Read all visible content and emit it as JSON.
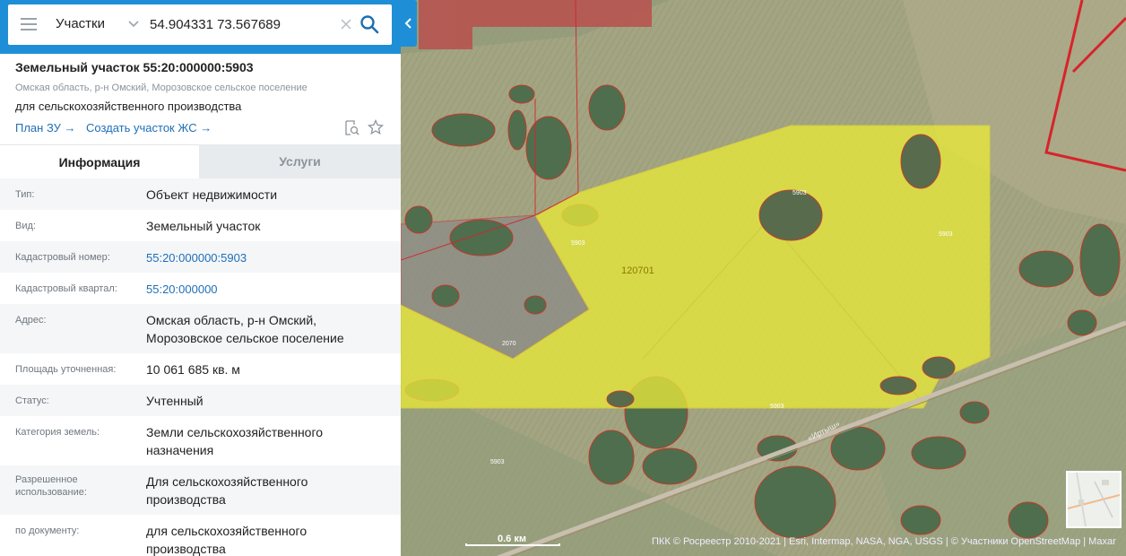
{
  "search": {
    "type_label": "Участки",
    "query": "54.904331 73.567689"
  },
  "object": {
    "title": "Земельный участок 55:20:000000:5903",
    "subtitle": "Омская область, р-н Омский, Морозовское сельское поселение",
    "purpose": "для сельскохозяйственного производства",
    "link_plan": "План ЗУ →",
    "link_create": "Создать участок ЖС →"
  },
  "tabs": {
    "info": "Информация",
    "services": "Услуги"
  },
  "info_rows": [
    {
      "label": "Тип:",
      "value": "Объект недвижимости"
    },
    {
      "label": "Вид:",
      "value": "Земельный участок"
    },
    {
      "label": "Кадастровый номер:",
      "value": "55:20:000000:5903"
    },
    {
      "label": "Кадастровый квартал:",
      "value": "55:20:000000"
    },
    {
      "label": "Адрес:",
      "value": "Омская область, р-н Омский, Морозовское сельское поселение"
    },
    {
      "label": "Площадь уточненная:",
      "value": "10 061 685 кв. м"
    },
    {
      "label": "Статус:",
      "value": "Учтенный"
    },
    {
      "label": "Категория земель:",
      "value": "Земли сельскохозяйственного назначения"
    },
    {
      "label": "Разрешенное использование:",
      "value": "Для сельскохозяйственного производства"
    },
    {
      "label": "по документу:",
      "value": "для сельскохозяйственного производства"
    }
  ],
  "map": {
    "parcel_label": "120701",
    "road_label": "«Иртыш»",
    "scale_label": "0.6 км",
    "attribution": "ПКК © Росреестр 2010-2021 | Esri, Intermap, NASA, NGA, USGS | © Участники OpenStreetMap | Maxar",
    "small_labels": [
      "5903",
      "5903",
      "5903",
      "5903",
      "2070",
      "5903"
    ],
    "colors": {
      "parcel_fill": "#e8e83a",
      "boundary": "#d6242a",
      "accent": "#1e8fd6"
    }
  }
}
